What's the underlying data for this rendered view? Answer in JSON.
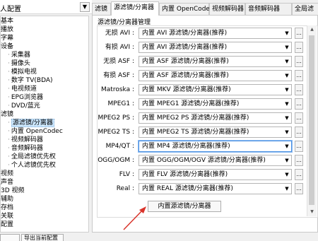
{
  "window": {
    "title": "人配置"
  },
  "tree": {
    "items": [
      {
        "label": "基本",
        "indent": 0,
        "selected": false
      },
      {
        "label": "播放",
        "indent": 0,
        "selected": false
      },
      {
        "label": "字幕",
        "indent": 0,
        "selected": false
      },
      {
        "label": "设备",
        "indent": 0,
        "selected": false
      },
      {
        "label": "采集器",
        "indent": 2,
        "selected": false
      },
      {
        "label": "摄像头",
        "indent": 2,
        "selected": false
      },
      {
        "label": "模拟电视",
        "indent": 2,
        "selected": false
      },
      {
        "label": "数字 TV(BDA)",
        "indent": 2,
        "selected": false
      },
      {
        "label": "电视频道",
        "indent": 2,
        "selected": false
      },
      {
        "label": "EPG浏览器",
        "indent": 2,
        "selected": false
      },
      {
        "label": "DVD/蓝光",
        "indent": 2,
        "selected": false
      },
      {
        "label": "滤镜",
        "indent": 0,
        "selected": false
      },
      {
        "label": "源滤镜/分离器",
        "indent": 2,
        "selected": true
      },
      {
        "label": "内置 OpenCodec",
        "indent": 2,
        "selected": false
      },
      {
        "label": "视频解码器",
        "indent": 2,
        "selected": false
      },
      {
        "label": "音频解码器",
        "indent": 2,
        "selected": false
      },
      {
        "label": "全局滤镜优先权",
        "indent": 2,
        "selected": false
      },
      {
        "label": "个人滤镜优先权",
        "indent": 2,
        "selected": false
      },
      {
        "label": "视频",
        "indent": 0,
        "selected": false
      },
      {
        "label": "声音",
        "indent": 0,
        "selected": false
      },
      {
        "label": "3D 视频",
        "indent": 0,
        "selected": false
      },
      {
        "label": "辅助",
        "indent": 0,
        "selected": false
      },
      {
        "label": "存档",
        "indent": 0,
        "selected": false
      },
      {
        "label": "关联",
        "indent": 0,
        "selected": false
      },
      {
        "label": "配置",
        "indent": 0,
        "selected": false
      }
    ]
  },
  "tabs": [
    {
      "label": "滤镜",
      "active": false
    },
    {
      "label": "源滤镜/分离器",
      "active": true
    },
    {
      "label": "内置 OpenCodec",
      "active": false
    },
    {
      "label": "视频解码器",
      "active": false
    },
    {
      "label": "音频解码器",
      "active": false
    },
    {
      "label": "全局滤",
      "active": false
    }
  ],
  "group": {
    "title": "源滤镜/分离器管理"
  },
  "rows": [
    {
      "label": "无损 AVI :",
      "value": "内置 AVI 源滤镜/分离器(推荐)",
      "more": "..."
    },
    {
      "label": "有损 AVI :",
      "value": "内置 AVI 源滤镜/分离器(推荐)",
      "more": "..."
    },
    {
      "label": "无损 ASF :",
      "value": "内置 ASF 源滤镜/分离器(推荐)",
      "more": "..."
    },
    {
      "label": "有损 ASF :",
      "value": "内置 ASF 源滤镜/分离器(推荐)",
      "more": "..."
    },
    {
      "label": "Matroska :",
      "value": "内置 MKV 源滤镜/分离器(推荐)",
      "more": "..."
    },
    {
      "label": "MPEG1 :",
      "value": "内置 MPEG1 源滤镜/分离器(推荐)",
      "more": "..."
    },
    {
      "label": "MPEG2 PS :",
      "value": "内置 MPEG2 PS 源滤镜/分离器(推荐)",
      "more": "..."
    },
    {
      "label": "MPEG2 TS :",
      "value": "内置 MPEG2 TS 源滤镜/分离器(推荐)",
      "more": "..."
    },
    {
      "label": "MP4/QT :",
      "value": "内置 MP4 源滤镜/分离器(推荐)",
      "more": "..."
    },
    {
      "label": "OGG/OGM :",
      "value": "内置 OGG/OGM/OGV 源滤镜/分离器(推荐)",
      "more": "..."
    },
    {
      "label": "FLV :",
      "value": "内置 FLV 源滤镜/分离器(推荐)",
      "more": "..."
    },
    {
      "label": "Real :",
      "value": "内置 REAL 源滤镜/分离器(推荐)",
      "more": "..."
    }
  ],
  "bottom_button": {
    "label": "内置源滤镜/分离器"
  },
  "footer": {
    "btn1": "",
    "btn2": "导出当前配置"
  },
  "colors": {
    "accent": "#4a90e2",
    "annotation_arrow": "#d9342b",
    "selection": "#cde8ff"
  }
}
